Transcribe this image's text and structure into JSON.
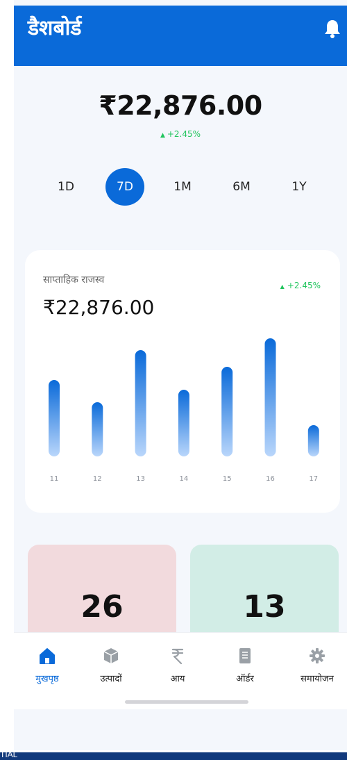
{
  "header": {
    "title": "डैशबोर्ड",
    "color": "#0a6ad9"
  },
  "summary": {
    "balance": "₹22,876.00",
    "change": "+2.45%"
  },
  "ranges": [
    {
      "label": "1D",
      "active": false
    },
    {
      "label": "7D",
      "active": true
    },
    {
      "label": "1M",
      "active": false
    },
    {
      "label": "6M",
      "active": false
    },
    {
      "label": "1Y",
      "active": false
    }
  ],
  "revenue_card": {
    "label": "साप्ताहिक राजस्व",
    "value": "₹22,876.00",
    "change": "+2.45%"
  },
  "chart_data": {
    "type": "bar",
    "categories": [
      "11",
      "12",
      "13",
      "14",
      "15",
      "16",
      "17"
    ],
    "values": [
      110,
      78,
      153,
      96,
      129,
      170,
      45
    ],
    "ylim": [
      0,
      180
    ],
    "grid": false,
    "bar_color_top": "#0a6ad9",
    "bar_color_bottom": "#b9d6fb"
  },
  "tiles": [
    {
      "value": "26",
      "color": "#f2dadd"
    },
    {
      "value": "13",
      "color": "#d2ede6"
    }
  ],
  "nav": [
    {
      "label": "मुखपृष्ठ",
      "icon": "home-icon",
      "active": true
    },
    {
      "label": "उत्पादों",
      "icon": "box-icon",
      "active": false
    },
    {
      "label": "आय",
      "icon": "rupee-icon",
      "active": false
    },
    {
      "label": "ऑर्डर",
      "icon": "document-icon",
      "active": false
    },
    {
      "label": "समायोजन",
      "icon": "gear-icon",
      "active": false
    }
  ],
  "footer_strip": {
    "text": "TIAL"
  }
}
